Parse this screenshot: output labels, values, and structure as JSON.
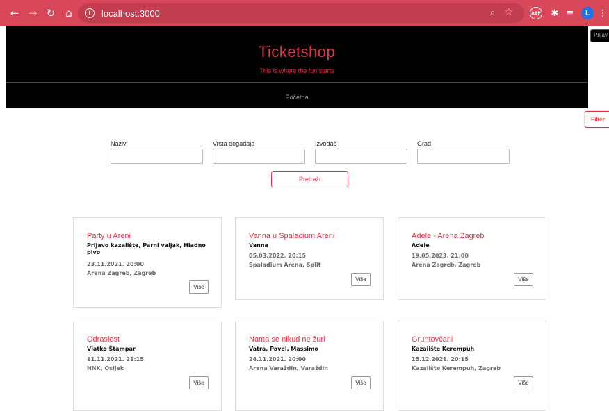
{
  "browser": {
    "url": "localhost:3000",
    "avatar_letter": "L",
    "abp_label": "ABP"
  },
  "header": {
    "brand": "Ticketshop",
    "tagline": "This is where the fun starts",
    "nav_home": "Početna"
  },
  "login_button": "Prijav",
  "filter_button": "Filter",
  "filters": {
    "naziv_label": "Naziv",
    "vrsta_label": "Vrsta događaja",
    "izvodac_label": "Izvođač",
    "grad_label": "Grad",
    "search_button": "Pretraži"
  },
  "events": [
    {
      "title": "Party u Areni",
      "performer": "Prljavo kazalište, Parni valjak, Hladno pivo",
      "datetime": "23.11.2021. 20:00",
      "venue": "Arena Zagreb, Zagreb",
      "more": "Više"
    },
    {
      "title": "Vanna u Spaladium Areni",
      "performer": "Vanna",
      "datetime": "05.03.2022. 20:15",
      "venue": "Spaladium Arena, Split",
      "more": "Više"
    },
    {
      "title": "Adele - Arena Zagreb",
      "performer": "Adele",
      "datetime": "19.05.2023. 21:00",
      "venue": "Arena Zagreb, Zagreb",
      "more": "Više"
    },
    {
      "title": "Odraslost",
      "performer": "Vlatko Štampar",
      "datetime": "11.11.2021. 21:15",
      "venue": "HNK, Osijek",
      "more": "Više"
    },
    {
      "title": "Nama se nikud ne žuri",
      "performer": "Vatra, Pavel, Massimo",
      "datetime": "24.11.2021. 20:00",
      "venue": "Arena Varaždin, Varaždin",
      "more": "Više"
    },
    {
      "title": "Gruntovčani",
      "performer": "Kazalište Kerempuh",
      "datetime": "15.12.2021. 20:15",
      "venue": "Kazalište Kerempuh, Zagreb",
      "more": "Više"
    }
  ],
  "colors": {
    "accent": "#e33346",
    "chrome": "#d9485a",
    "header_bg": "#000000"
  }
}
